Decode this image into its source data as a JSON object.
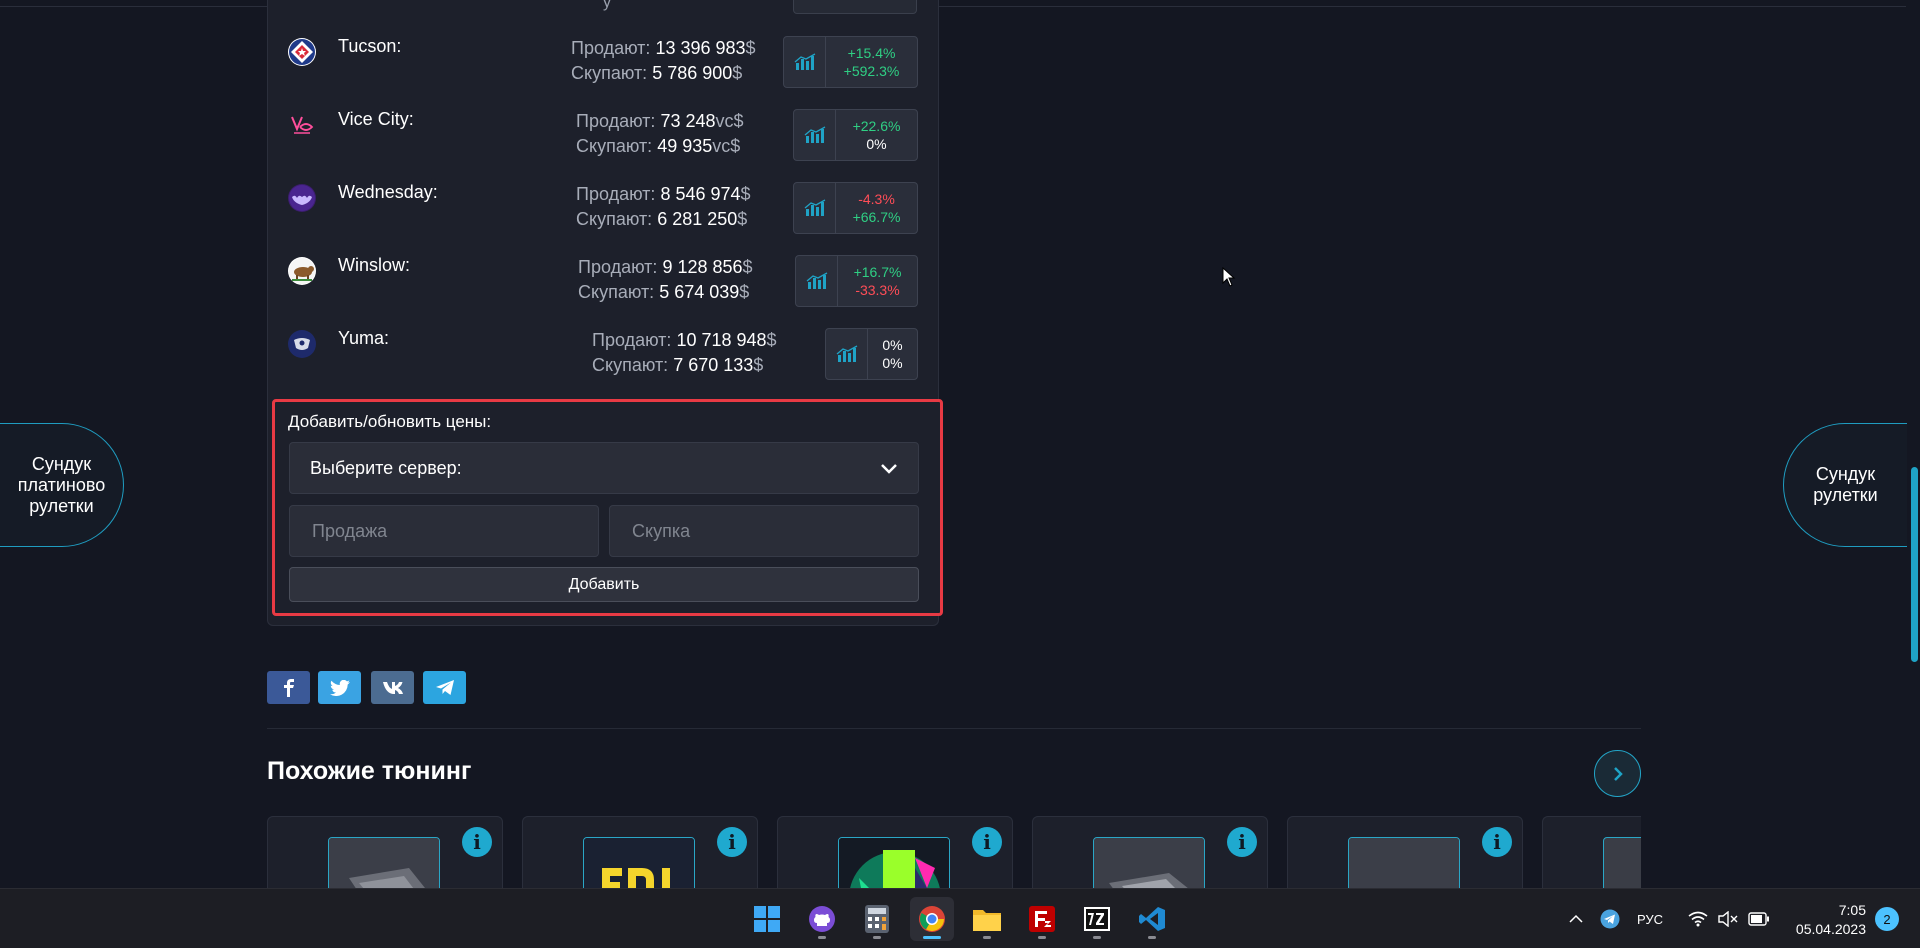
{
  "panel": {
    "peek_text": "y"
  },
  "servers": [
    {
      "name": "Tucson:",
      "sell_label": "Продают:",
      "sell_value": "13 396 983",
      "buy_label": "Скупают:",
      "buy_value": "5 786 900",
      "currency": "$",
      "change_sell": "+15.4%",
      "change_buy": "+592.3%",
      "icon": "tucson-star-icon"
    },
    {
      "name": "Vice City:",
      "sell_label": "Продают:",
      "sell_value": "73 248",
      "buy_label": "Скупают:",
      "buy_value": "49 935",
      "currency": "vc$",
      "change_sell": "+22.6%",
      "change_buy": "0%",
      "icon": "vice-city-logo-icon"
    },
    {
      "name": "Wednesday:",
      "sell_label": "Продают:",
      "sell_value": "8 546 974",
      "buy_label": "Скупают:",
      "buy_value": "6 281 250",
      "currency": "$",
      "change_sell": "-4.3%",
      "change_buy": "+66.7%",
      "icon": "wednesday-bat-icon"
    },
    {
      "name": "Winslow:",
      "sell_label": "Продают:",
      "sell_value": "9 128 856",
      "buy_label": "Скупают:",
      "buy_value": "5 674 039",
      "currency": "$",
      "change_sell": "+16.7%",
      "change_buy": "-33.3%",
      "icon": "winslow-bear-icon"
    },
    {
      "name": "Yuma:",
      "sell_label": "Продают:",
      "sell_value": "10 718 948",
      "buy_label": "Скупают:",
      "buy_value": "7 670 133",
      "currency": "$",
      "change_sell": "0%",
      "change_buy": "0%",
      "icon": "yuma-seal-icon"
    }
  ],
  "form": {
    "title": "Добавить/обновить цены:",
    "select_value": "Выберите сервер:",
    "sell_placeholder": "Продажа",
    "buy_placeholder": "Скупка",
    "add_label": "Добавить"
  },
  "social": [
    "facebook-icon",
    "twitter-icon",
    "vk-icon",
    "telegram-icon"
  ],
  "similar": {
    "title": "Похожие тюнинг",
    "info_glyph": "i"
  },
  "side": {
    "left_label": "Сундук платиново рулетки",
    "right_label": "Сундук рулетки"
  },
  "taskbar": {
    "language": "РУС",
    "time": "7:05",
    "date": "05.04.2023",
    "notifications": "2"
  },
  "colors": {
    "accent": "#1fa3c6",
    "positive": "#2fcf84",
    "negative": "#ff4d57",
    "form_border": "#e83a44"
  }
}
